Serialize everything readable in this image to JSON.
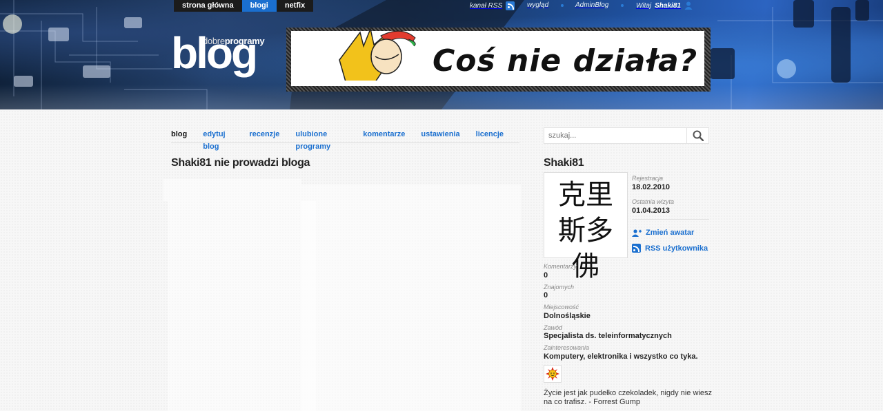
{
  "topnav": {
    "items": [
      {
        "label": "strona główna",
        "active": false
      },
      {
        "label": "blogi",
        "active": true
      },
      {
        "label": "netfix",
        "active": false
      }
    ]
  },
  "userbar": {
    "rss_label": "kanał RSS",
    "wyglad_label": "wygląd",
    "admin_label": "AdminBlog",
    "greeting": "Witaj",
    "username": "Shaki81"
  },
  "logo": {
    "sub_light": "dobre",
    "sub_bold": "programy",
    "big": "blog"
  },
  "banner": {
    "text": "Coś nie działa?"
  },
  "subnav": {
    "items": [
      {
        "label": "blog",
        "active": true
      },
      {
        "label": "edytuj blog",
        "active": false
      },
      {
        "label": "recenzje",
        "active": false
      },
      {
        "label": "ulubione programy",
        "active": false
      },
      {
        "label": "komentarze",
        "active": false
      },
      {
        "label": "ustawienia",
        "active": false
      },
      {
        "label": "licencje",
        "active": false
      }
    ]
  },
  "main": {
    "title": "Shaki81 nie prowadzi bloga"
  },
  "search": {
    "placeholder": "szukaj..."
  },
  "profile": {
    "name": "Shaki81",
    "avatar_text": "克里斯多佛",
    "registration_label": "Rejestracja",
    "registration_date": "18.02.2010",
    "last_visit_label": "Ostatnia wizyta",
    "last_visit_date": "01.04.2013",
    "change_avatar": "Zmień awatar",
    "user_rss": "RSS użytkownika",
    "comments_label": "Komentarzy",
    "comments_value": "0",
    "friends_label": "Znajomych",
    "friends_value": "0",
    "city_label": "Miejscowość",
    "city_value": "Dolnośląskie",
    "job_label": "Zawód",
    "job_value": "Specjalista ds. teleinformatycznych",
    "interests_label": "Zainteresowania",
    "interests_value": "Komputery, elektronika i wszystko co tyka.",
    "quote": "Życie jest jak pudełko czekoladek, nigdy nie wiesz na co trafisz. - Forrest Gump"
  },
  "colors": {
    "accent": "#1a6fcf",
    "topnav_bg": "#1b1b1b"
  }
}
